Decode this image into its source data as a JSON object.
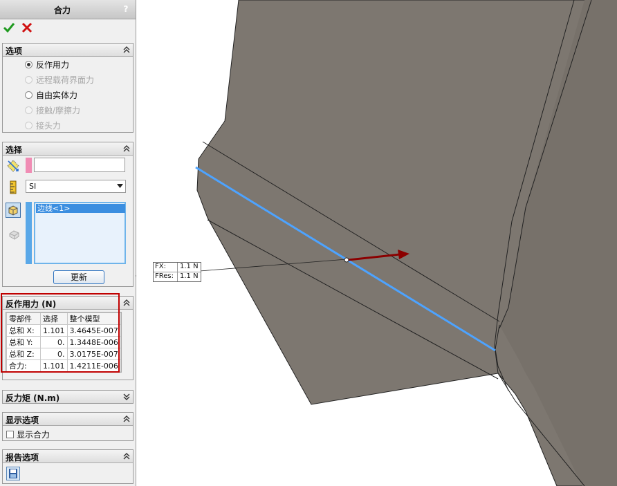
{
  "panel": {
    "title": "合力",
    "help": "?",
    "options": {
      "title": "选项",
      "items": [
        {
          "label": "反作用力",
          "state": "selected"
        },
        {
          "label": "远程载荷界面力",
          "state": "disabled"
        },
        {
          "label": "自由实体力",
          "state": "enabled"
        },
        {
          "label": "接触/摩擦力",
          "state": "disabled"
        },
        {
          "label": "接头力",
          "state": "disabled"
        }
      ]
    },
    "selection": {
      "title": "选择",
      "face_value": "",
      "unit": "SI",
      "list_item": "边线<1>",
      "update_label": "更新"
    },
    "reaction": {
      "title": "反作用力 (N)",
      "headers": [
        "零部件",
        "选择",
        "整个模型"
      ],
      "rows": [
        [
          "总和 X:",
          "1.101",
          "3.4645E-007"
        ],
        [
          "总和 Y:",
          "0.",
          "1.3448E-006"
        ],
        [
          "总和 Z:",
          "0.",
          "3.0175E-007"
        ],
        [
          "合力:",
          "1.101",
          "1.4211E-006"
        ]
      ]
    },
    "moment": {
      "title": "反力矩 (N.m)"
    },
    "display": {
      "title": "显示选项",
      "checkbox_label": "显示合力",
      "checked": false
    },
    "report": {
      "title": "报告选项"
    }
  },
  "callout": {
    "rows": [
      {
        "label": "FX:",
        "value": "1.1 N"
      },
      {
        "label": "FRes:",
        "value": "1.1 N"
      }
    ]
  },
  "colors": {
    "highlight_border": "#c00000",
    "selected_edge": "#4da3ff",
    "arrow": "#8b0000",
    "model_face": "#7d7770",
    "selection_swatch": "#f08cb4"
  }
}
